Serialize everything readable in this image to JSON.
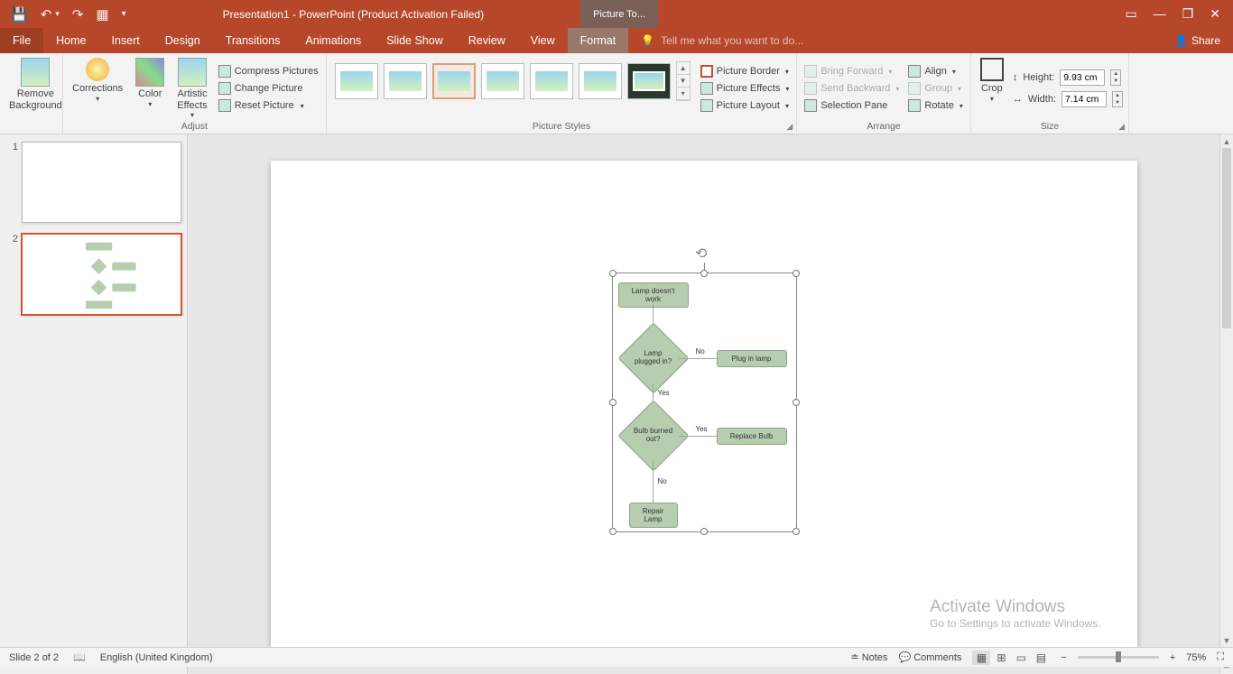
{
  "app": {
    "title": "Presentation1 - PowerPoint (Product Activation Failed)",
    "contextual_tab_group": "Picture To..."
  },
  "tabs": {
    "file": "File",
    "home": "Home",
    "insert": "Insert",
    "design": "Design",
    "transitions": "Transitions",
    "animations": "Animations",
    "slideshow": "Slide Show",
    "review": "Review",
    "view": "View",
    "format": "Format",
    "tell_me": "Tell me what you want to do...",
    "share": "Share"
  },
  "ribbon": {
    "remove_bg": "Remove\nBackground",
    "corrections": "Corrections",
    "color": "Color",
    "artistic": "Artistic\nEffects",
    "compress": "Compress Pictures",
    "change": "Change Picture",
    "reset": "Reset Picture",
    "adjust_label": "Adjust",
    "styles_label": "Picture Styles",
    "border": "Picture Border",
    "effects": "Picture Effects",
    "layout": "Picture Layout",
    "arrange_label": "Arrange",
    "bring_forward": "Bring Forward",
    "send_backward": "Send Backward",
    "selection_pane": "Selection Pane",
    "align": "Align",
    "group": "Group",
    "rotate": "Rotate",
    "crop": "Crop",
    "size_label": "Size",
    "height_label": "Height:",
    "height_value": "9.93 cm",
    "width_label": "Width:",
    "width_value": "7.14 cm"
  },
  "chart_data": {
    "type": "flowchart",
    "nodes": [
      {
        "id": "start",
        "shape": "terminator",
        "text": "Lamp doesn't work"
      },
      {
        "id": "d1",
        "shape": "decision",
        "text": "Lamp plugged in?"
      },
      {
        "id": "a1",
        "shape": "process",
        "text": "Plug in lamp"
      },
      {
        "id": "d2",
        "shape": "decision",
        "text": "Bulb burned out?"
      },
      {
        "id": "a2",
        "shape": "process",
        "text": "Replace Bulb"
      },
      {
        "id": "end",
        "shape": "terminator",
        "text": "Repair Lamp"
      }
    ],
    "edges": [
      {
        "from": "start",
        "to": "d1"
      },
      {
        "from": "d1",
        "to": "a1",
        "label": "No"
      },
      {
        "from": "d1",
        "to": "d2",
        "label": "Yes"
      },
      {
        "from": "d2",
        "to": "a2",
        "label": "Yes"
      },
      {
        "from": "d2",
        "to": "end",
        "label": "No"
      }
    ]
  },
  "status": {
    "slide": "Slide 2 of 2",
    "lang": "English (United Kingdom)",
    "notes": "Notes",
    "comments": "Comments",
    "zoom": "75%"
  },
  "activate": {
    "title": "Activate Windows",
    "sub": "Go to Settings to activate Windows."
  }
}
